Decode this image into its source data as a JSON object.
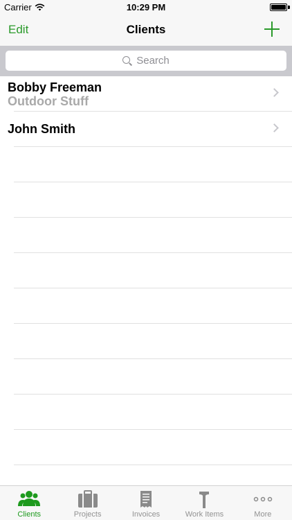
{
  "status_bar": {
    "carrier": "Carrier",
    "time": "10:29 PM"
  },
  "nav": {
    "edit_label": "Edit",
    "title": "Clients",
    "add_icon": "plus-icon"
  },
  "search": {
    "placeholder": "Search"
  },
  "clients": [
    {
      "name": "Bobby Freeman",
      "company": "Outdoor Stuff"
    },
    {
      "name": "John Smith",
      "company": ""
    }
  ],
  "tabs": [
    {
      "label": "Clients",
      "icon": "people-icon",
      "active": true
    },
    {
      "label": "Projects",
      "icon": "briefcase-icon",
      "active": false
    },
    {
      "label": "Invoices",
      "icon": "receipt-icon",
      "active": false
    },
    {
      "label": "Work Items",
      "icon": "hammer-icon",
      "active": false
    },
    {
      "label": "More",
      "icon": "more-dots-icon",
      "active": false
    }
  ],
  "colors": {
    "accent": "#2a9a2a",
    "tab_inactive": "#929292",
    "subtitle": "#a9a9a9"
  }
}
